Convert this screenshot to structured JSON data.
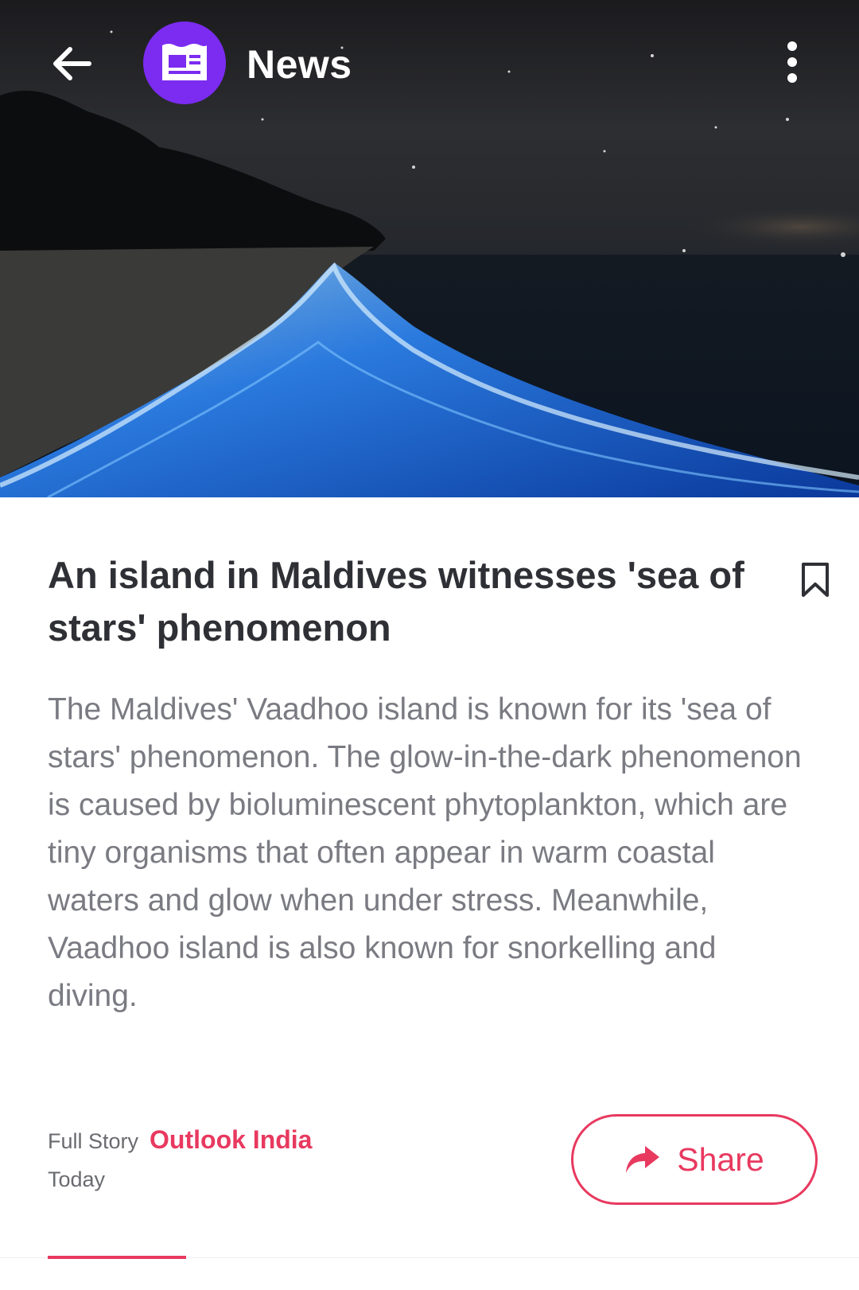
{
  "appbar": {
    "title": "News",
    "back_icon": "arrow-left-icon",
    "app_icon": "newspaper-icon",
    "more_icon": "more-vert-icon",
    "app_icon_color": "#7b2cf0"
  },
  "article": {
    "headline": "An island in Maldives witnesses 'sea of stars' phenomenon",
    "body": "The Maldives' Vaadhoo island is known for its 'sea of stars' phenomenon. The glow-in-the-dark phenomenon is caused by bioluminescent phytoplankton, which are tiny organisms that often appear in warm coastal waters and glow when under stress. Meanwhile, Vaadhoo island is also known for snorkelling and diving.",
    "full_story_label": "Full Story",
    "source": "Outlook India",
    "date": "Today",
    "bookmark_icon": "bookmark-outline-icon"
  },
  "share": {
    "label": "Share",
    "icon": "share-arrow-icon"
  },
  "colors": {
    "accent": "#e8395f",
    "headline": "#2f3035",
    "body": "#7a7b82"
  }
}
